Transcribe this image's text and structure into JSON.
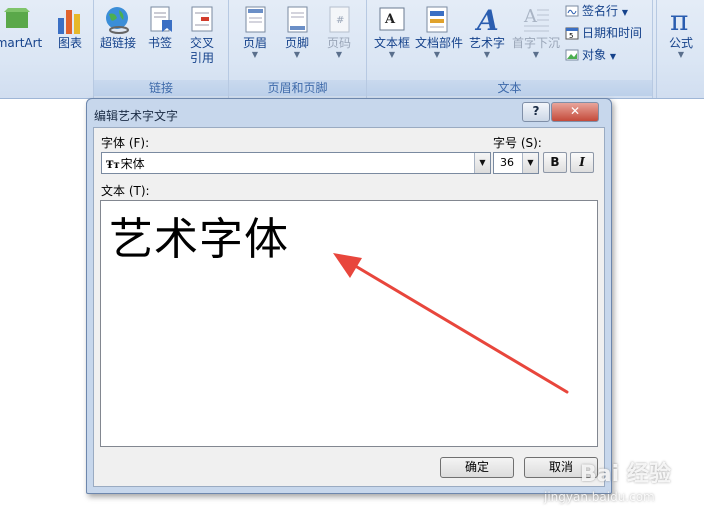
{
  "ribbon": {
    "groups": {
      "illustrations": {
        "smartart_label": "martArt",
        "chart_label": "图表"
      },
      "links": {
        "hyperlink_label": "超链接",
        "bookmark_label": "书签",
        "crossref_label_line1": "交叉",
        "crossref_label_line2": "引用",
        "group_label": "链接"
      },
      "header_footer": {
        "header_label": "页眉",
        "footer_label": "页脚",
        "page_number_label": "页码",
        "group_label": "页眉和页脚"
      },
      "text": {
        "textbox_label": "文本框",
        "quickparts_label": "文档部件",
        "wordart_label": "艺术字",
        "dropcap_label": "首字下沉",
        "signature_label": "签名行",
        "datetime_label": "日期和时间",
        "object_label": "对象",
        "group_label": "文本"
      },
      "symbols": {
        "equation_label": "公式"
      }
    }
  },
  "dialog": {
    "title": "编辑艺术字文字",
    "help_label": "?",
    "close_label": "✕",
    "font_label": "字体 (F):",
    "font_value": "宋体",
    "size_label": "字号 (S):",
    "size_value": "36",
    "bold_label": "B",
    "italic_label": "I",
    "text_label": "文本 (T):",
    "text_value": "艺术字体",
    "ok_label": "确定",
    "cancel_label": "取消"
  },
  "watermark": {
    "main": "Bai 经验",
    "url": "jingyan.baidu.com"
  },
  "colors": {
    "ribbon_bg": "#dbe6f4",
    "ribbon_text": "#15428b",
    "dialog_frame": "#c7d7ec",
    "arrow": "#e8463c"
  }
}
